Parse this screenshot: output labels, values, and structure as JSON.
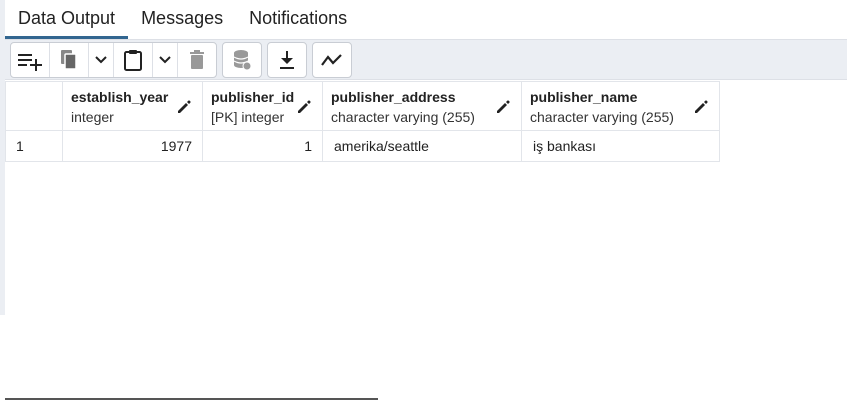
{
  "tabs": [
    {
      "label": "Data Output",
      "active": true
    },
    {
      "label": "Messages",
      "active": false
    },
    {
      "label": "Notifications",
      "active": false
    }
  ],
  "toolbar": {
    "buttons": [
      "add-row-icon",
      "copy-icon",
      "chevron-down-icon",
      "paste-icon",
      "chevron-down-icon",
      "delete-icon",
      "save-data-icon",
      "download-icon",
      "graph-icon"
    ]
  },
  "grid": {
    "columns": [
      {
        "name": "establish_year",
        "type": "integer"
      },
      {
        "name": "publisher_id",
        "type": "[PK] integer"
      },
      {
        "name": "publisher_address",
        "type": "character varying (255)"
      },
      {
        "name": "publisher_name",
        "type": "character varying (255)"
      }
    ],
    "rows": [
      {
        "num": "1",
        "cells": [
          "1977",
          "1",
          "amerika/seattle",
          "iş bankası"
        ]
      }
    ]
  },
  "colors": {
    "active_tab": "#326690",
    "toolbar_bg": "#ebeef3",
    "icon": "#222222"
  }
}
